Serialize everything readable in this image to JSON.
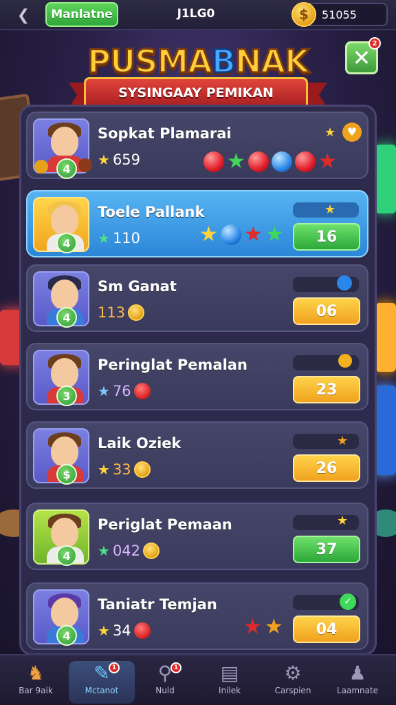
{
  "topbar": {
    "mode_label": "Manlatne",
    "title": "J1LG0",
    "coins": "51055"
  },
  "header": {
    "game_title_a": "PUSMA",
    "game_title_b": "B",
    "game_title_c": "NAK",
    "ribbon": "SYSINGAAY PEMIKAN",
    "close_badge": "2"
  },
  "players": [
    {
      "name": "Sopkat Plamarai",
      "score": "659",
      "level": "4",
      "button": ""
    },
    {
      "name": "Toele Pallank",
      "score": "110",
      "level": "4",
      "button": "16"
    },
    {
      "name": "Sm Ganat",
      "score": "113",
      "level": "4",
      "button": "06"
    },
    {
      "name": "Peringlat Pemalan",
      "score": "76",
      "level": "3",
      "button": "23"
    },
    {
      "name": "Laik Oziek",
      "score": "33",
      "level": "$",
      "button": "26"
    },
    {
      "name": "Periglat Pemaan",
      "score": "042",
      "level": "4",
      "button": "37"
    },
    {
      "name": "Taniatr Temjan",
      "score": "34",
      "level": "4",
      "button": "04"
    }
  ],
  "nav": {
    "items": [
      {
        "label": "Bar 9aik",
        "icon": "horse-icon"
      },
      {
        "label": "Mctanot",
        "icon": "edit-icon",
        "badge": "1"
      },
      {
        "label": "Nuld",
        "icon": "search-icon",
        "badge": "1"
      },
      {
        "label": "Inilek",
        "icon": "list-icon"
      },
      {
        "label": "Carspien",
        "icon": "gear-icon"
      },
      {
        "label": "Laamnate",
        "icon": "profile-icon"
      }
    ]
  },
  "colors": {
    "accent_green": "#2fa63a",
    "accent_yellow": "#f0a21e",
    "highlight_blue": "#2c86d8",
    "panel": "#2e2a4c"
  }
}
